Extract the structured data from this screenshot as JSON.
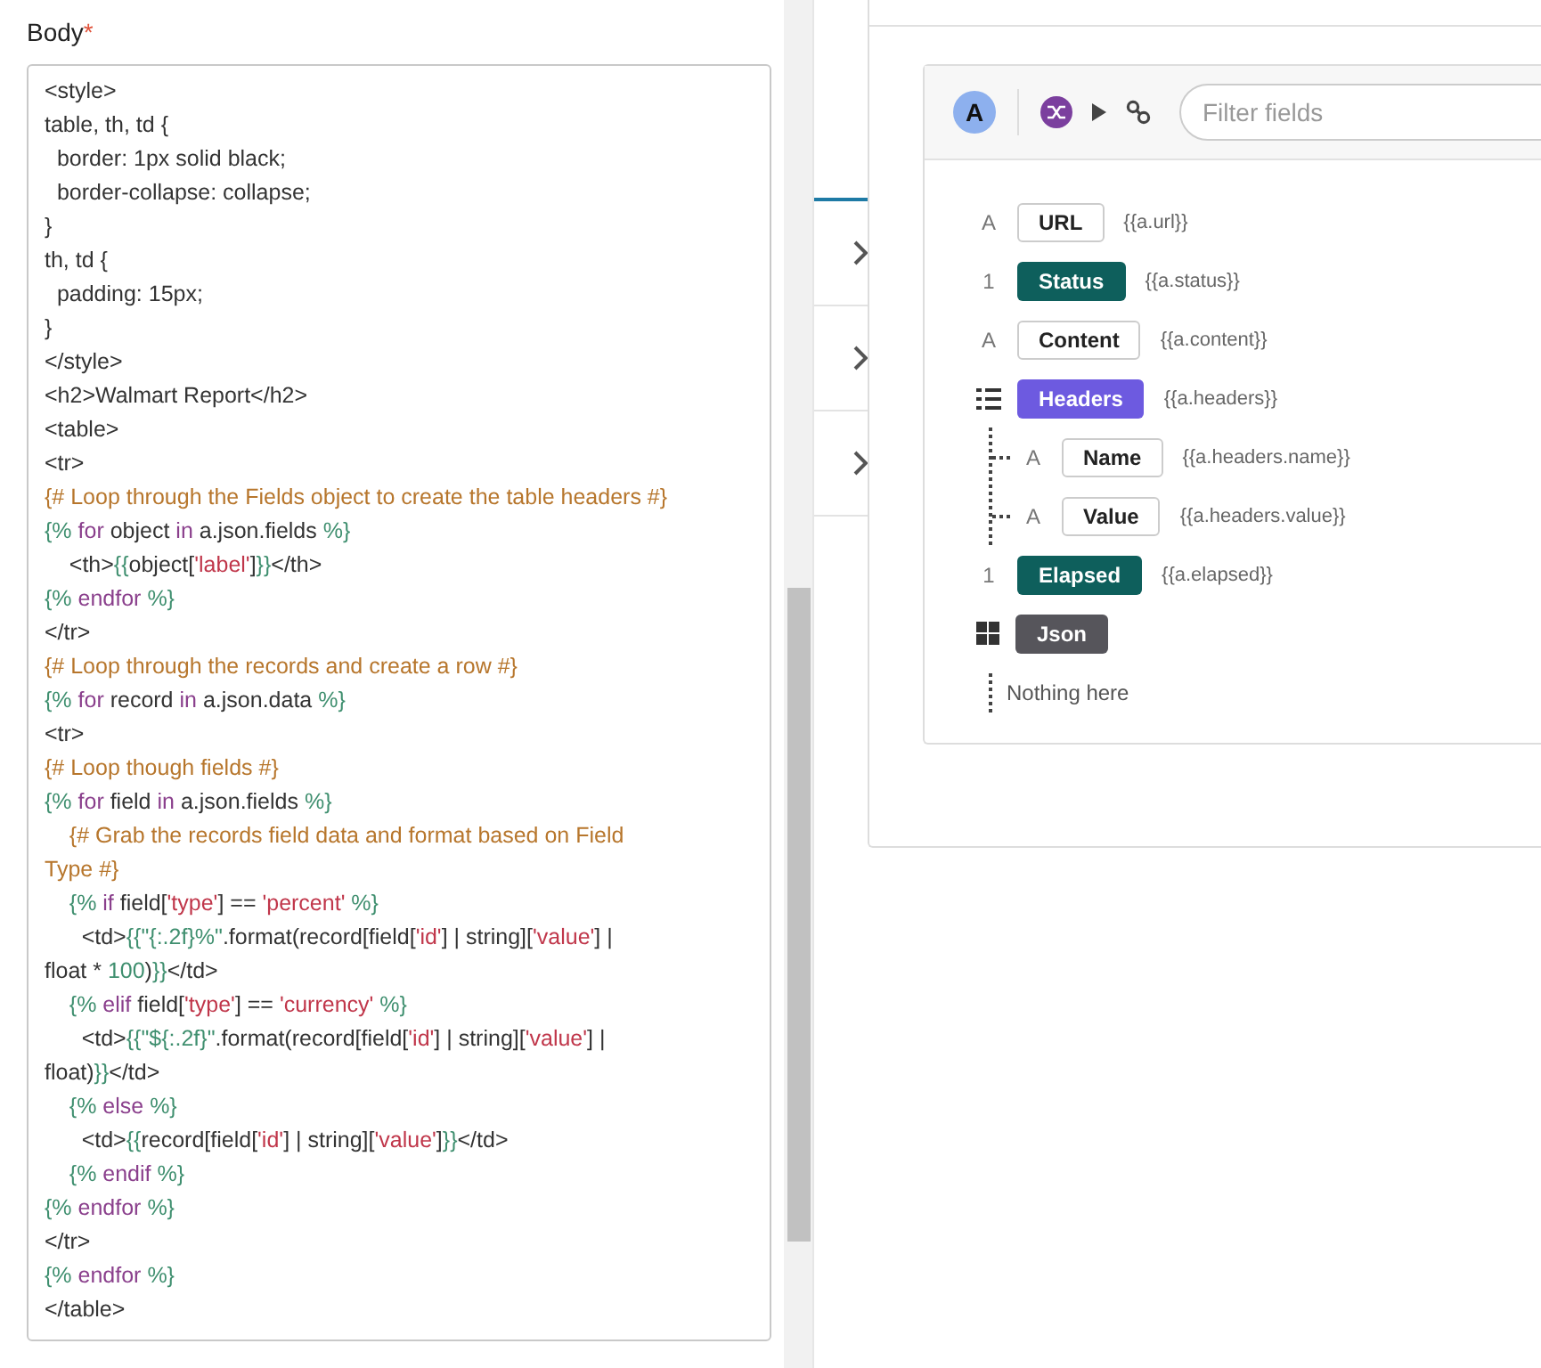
{
  "body_field": {
    "label": "Body",
    "required_mark": "*",
    "lines": [
      [
        {
          "kind": "text",
          "text": "<style>"
        }
      ],
      [
        {
          "kind": "text",
          "text": "table, th, td {"
        }
      ],
      [
        {
          "kind": "text",
          "text": "  border: 1px solid black;"
        }
      ],
      [
        {
          "kind": "text",
          "text": "  border-collapse: collapse;"
        }
      ],
      [
        {
          "kind": "text",
          "text": "}"
        }
      ],
      [
        {
          "kind": "text",
          "text": "th, td {"
        }
      ],
      [
        {
          "kind": "text",
          "text": "  padding: 15px;"
        }
      ],
      [
        {
          "kind": "text",
          "text": "}"
        }
      ],
      [
        {
          "kind": "text",
          "text": "</style>"
        }
      ],
      [
        {
          "kind": "text",
          "text": "<h2>Walmart Report</h2>"
        }
      ],
      [
        {
          "kind": "text",
          "text": "<table>"
        }
      ],
      [
        {
          "kind": "text",
          "text": "<tr>"
        }
      ],
      [
        {
          "kind": "comment",
          "text": "{# Loop through the Fields object to create the table headers #}"
        }
      ],
      [
        {
          "kind": "delim",
          "text": "{% "
        },
        {
          "kind": "keyword",
          "text": "for"
        },
        {
          "kind": "text",
          "text": " object "
        },
        {
          "kind": "keyword",
          "text": "in"
        },
        {
          "kind": "text",
          "text": " a.json.fields "
        },
        {
          "kind": "delim",
          "text": "%}"
        }
      ],
      [
        {
          "kind": "text",
          "text": "    <th>"
        },
        {
          "kind": "delim",
          "text": "{{"
        },
        {
          "kind": "text",
          "text": "object["
        },
        {
          "kind": "string",
          "text": "'label'"
        },
        {
          "kind": "text",
          "text": "]"
        },
        {
          "kind": "delim",
          "text": "}}"
        },
        {
          "kind": "text",
          "text": "</th>"
        }
      ],
      [
        {
          "kind": "delim",
          "text": "{% "
        },
        {
          "kind": "keyword",
          "text": "endfor"
        },
        {
          "kind": "delim",
          "text": " %}"
        }
      ],
      [
        {
          "kind": "text",
          "text": "</tr>"
        }
      ],
      [
        {
          "kind": "comment",
          "text": "{# Loop through the records and create a row #}"
        }
      ],
      [
        {
          "kind": "delim",
          "text": "{% "
        },
        {
          "kind": "keyword",
          "text": "for"
        },
        {
          "kind": "text",
          "text": " record "
        },
        {
          "kind": "keyword",
          "text": "in"
        },
        {
          "kind": "text",
          "text": " a.json.data "
        },
        {
          "kind": "delim",
          "text": "%}"
        }
      ],
      [
        {
          "kind": "text",
          "text": "<tr>"
        }
      ],
      [
        {
          "kind": "comment",
          "text": "{# Loop though fields #}"
        }
      ],
      [
        {
          "kind": "delim",
          "text": "{% "
        },
        {
          "kind": "keyword",
          "text": "for"
        },
        {
          "kind": "text",
          "text": " field "
        },
        {
          "kind": "keyword",
          "text": "in"
        },
        {
          "kind": "text",
          "text": " a.json.fields "
        },
        {
          "kind": "delim",
          "text": "%}"
        }
      ],
      [
        {
          "kind": "comment",
          "text": "    {# Grab the records field data and format based on Field"
        }
      ],
      [
        {
          "kind": "comment",
          "text": "Type #}"
        }
      ],
      [
        {
          "kind": "delim",
          "text": "    {% "
        },
        {
          "kind": "keyword",
          "text": "if"
        },
        {
          "kind": "text",
          "text": " field["
        },
        {
          "kind": "string",
          "text": "'type'"
        },
        {
          "kind": "text",
          "text": "] == "
        },
        {
          "kind": "string",
          "text": "'percent'"
        },
        {
          "kind": "delim",
          "text": " %}"
        }
      ],
      [
        {
          "kind": "text",
          "text": "      <td>"
        },
        {
          "kind": "delim",
          "text": "{{\"{:.2f}%\""
        },
        {
          "kind": "text",
          "text": ".format(record[field["
        },
        {
          "kind": "string",
          "text": "'id'"
        },
        {
          "kind": "text",
          "text": "] | string]["
        },
        {
          "kind": "string",
          "text": "'value'"
        },
        {
          "kind": "text",
          "text": "] |"
        }
      ],
      [
        {
          "kind": "text",
          "text": "float * "
        },
        {
          "kind": "delim",
          "text": "100"
        },
        {
          "kind": "text",
          "text": ")"
        },
        {
          "kind": "delim",
          "text": "}}"
        },
        {
          "kind": "text",
          "text": "</td>"
        }
      ],
      [
        {
          "kind": "delim",
          "text": "    {% "
        },
        {
          "kind": "keyword",
          "text": "elif"
        },
        {
          "kind": "text",
          "text": " field["
        },
        {
          "kind": "string",
          "text": "'type'"
        },
        {
          "kind": "text",
          "text": "] == "
        },
        {
          "kind": "string",
          "text": "'currency'"
        },
        {
          "kind": "delim",
          "text": " %}"
        }
      ],
      [
        {
          "kind": "text",
          "text": "      <td>"
        },
        {
          "kind": "delim",
          "text": "{{\"${:.2f}\""
        },
        {
          "kind": "text",
          "text": ".format(record[field["
        },
        {
          "kind": "string",
          "text": "'id'"
        },
        {
          "kind": "text",
          "text": "] | string]["
        },
        {
          "kind": "string",
          "text": "'value'"
        },
        {
          "kind": "text",
          "text": "] |"
        }
      ],
      [
        {
          "kind": "text",
          "text": "float)"
        },
        {
          "kind": "delim",
          "text": "}}"
        },
        {
          "kind": "text",
          "text": "</td>"
        }
      ],
      [
        {
          "kind": "delim",
          "text": "    {% "
        },
        {
          "kind": "keyword",
          "text": "else"
        },
        {
          "kind": "delim",
          "text": " %}"
        }
      ],
      [
        {
          "kind": "text",
          "text": "      <td>"
        },
        {
          "kind": "delim",
          "text": "{{"
        },
        {
          "kind": "text",
          "text": "record[field["
        },
        {
          "kind": "string",
          "text": "'id'"
        },
        {
          "kind": "text",
          "text": "] | string]["
        },
        {
          "kind": "string",
          "text": "'value'"
        },
        {
          "kind": "text",
          "text": "]"
        },
        {
          "kind": "delim",
          "text": "}}"
        },
        {
          "kind": "text",
          "text": "</td>"
        }
      ],
      [
        {
          "kind": "delim",
          "text": "    {% "
        },
        {
          "kind": "keyword",
          "text": "endif"
        },
        {
          "kind": "delim",
          "text": " %}"
        }
      ],
      [
        {
          "kind": "delim",
          "text": "{% "
        },
        {
          "kind": "keyword",
          "text": "endfor"
        },
        {
          "kind": "delim",
          "text": " %}"
        }
      ],
      [
        {
          "kind": "text",
          "text": "</tr>"
        }
      ],
      [
        {
          "kind": "delim",
          "text": "{% "
        },
        {
          "kind": "keyword",
          "text": "endfor"
        },
        {
          "kind": "delim",
          "text": " %}"
        }
      ],
      [
        {
          "kind": "text",
          "text": "</table>"
        }
      ]
    ]
  },
  "data_picker": {
    "step_letter": "A",
    "filter": {
      "placeholder": "Filter fields"
    },
    "fields": [
      {
        "kind": "text",
        "type_mark": "A",
        "label": "URL",
        "token": "{{a.url}}"
      },
      {
        "kind": "number",
        "type_mark": "1",
        "label": "Status",
        "token": "{{a.status}}"
      },
      {
        "kind": "text",
        "type_mark": "A",
        "label": "Content",
        "token": "{{a.content}}"
      },
      {
        "kind": "list",
        "label": "Headers",
        "token": "{{a.headers}}",
        "children": [
          {
            "kind": "text",
            "type_mark": "A",
            "label": "Name",
            "token": "{{a.headers.name}}"
          },
          {
            "kind": "text",
            "type_mark": "A",
            "label": "Value",
            "token": "{{a.headers.value}}"
          }
        ]
      },
      {
        "kind": "number",
        "type_mark": "1",
        "label": "Elapsed",
        "token": "{{a.elapsed}}"
      },
      {
        "kind": "object",
        "label": "Json",
        "empty_text": "Nothing here"
      }
    ]
  }
}
